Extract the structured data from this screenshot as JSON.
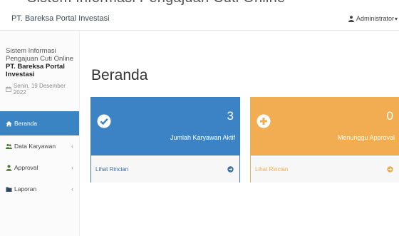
{
  "top_cut_text": "Sistem Informasi Pengajuan Cuti Online",
  "header": {
    "brand": "PT. Bareksa Portal Investasi",
    "user": "Administrator"
  },
  "sidebar": {
    "system_title": "Sistem Informasi Pengajuan Cuti Online",
    "company": "PT. Bareksa Portal Investasi",
    "date": "Senin, 19 Desember 2022",
    "items": [
      {
        "label": "Beranda",
        "icon": "home-icon",
        "active": true
      },
      {
        "label": "Data Karyawan",
        "icon": "users-icon"
      },
      {
        "label": "Approval",
        "icon": "user-icon"
      },
      {
        "label": "Laporan",
        "icon": "folder-icon"
      }
    ]
  },
  "main": {
    "title": "Beranda",
    "cards": [
      {
        "count": "3",
        "label": "Jumlah Karyawan Aktif",
        "link": "Lihat Rincian",
        "color": "#3b83c4",
        "icon": "check-circle-icon"
      },
      {
        "count": "0",
        "label": "Menunggu Approval",
        "link": "Lihat Rincian",
        "color": "#f2ad52",
        "icon": "plus-circle-icon"
      }
    ]
  }
}
